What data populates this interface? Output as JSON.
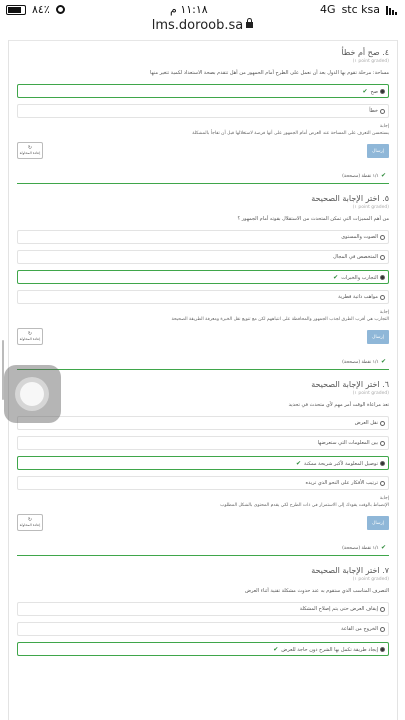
{
  "status_bar": {
    "carrier": "stc ksa",
    "network": "4G",
    "time": "١١:١٨ م",
    "battery": "٨٤٪"
  },
  "browser": {
    "url": "lms.doroob.sa"
  },
  "questions": [
    {
      "title": "٤. صح أم خطأ",
      "points": "(point graded ١)",
      "text": "مساحة: مرحلة تقوم بها الدول بعد أن نعمل على الطرح أمام الحمهور من أهل تتقدم بصحة الاستعداد لكمية تتغير منها",
      "options": [
        {
          "label": "صح",
          "selected": true,
          "correct": true
        },
        {
          "label": "خطأ",
          "selected": false,
          "correct": false
        }
      ],
      "answer_label": "إجابة",
      "answer_text": "يستحسن التعرف على المساحة عند العرض أمام الجمهور على أنها فرصة لاستغلالها قبل أن تفاجأ بالمشكلة",
      "send_label": "إرسال",
      "retry_label": "إعادة المحاولة",
      "result": "١/١ نقطة (مصححة)"
    },
    {
      "title": "٥. اختر الإجابة الصحيحة",
      "points": "(point graded ١)",
      "text": "من أهم المميزات التي تمكن المتحدث من الاستقلال بقوته أمام الجمهور ؟",
      "options": [
        {
          "label": "الصوت والمستوى",
          "selected": false,
          "correct": false
        },
        {
          "label": "المتخصص في المجال",
          "selected": false,
          "correct": false
        },
        {
          "label": "التجارب والخبرات",
          "selected": true,
          "correct": true
        },
        {
          "label": "مواهب ذاتية فطرية",
          "selected": false,
          "correct": false
        }
      ],
      "answer_label": "إجابة",
      "answer_text": "التجارب هي أقرب الطرق لجذب الجمهور والمحافظة على انتباههم لكن مع تنويع نقل الخبرة ومعرفة الطريقة الصحيحة",
      "send_label": "إرسال",
      "retry_label": "إعادة المحاولة",
      "result": "١/١ نقطة (مصححة)"
    },
    {
      "title": "٦. اختر الإجابة الصحيحة",
      "points": "(point graded ١)",
      "text": "تعد مراعاة الوقت أمر مهم لأي متحدث في تحديد",
      "options": [
        {
          "label": "نقل العرض",
          "selected": false,
          "correct": false
        },
        {
          "label": "بين المعلومات التي ستعرضها",
          "selected": false,
          "correct": false
        },
        {
          "label": "توصيل المعلومة لأكبر شريحة ممكنة",
          "selected": true,
          "correct": true
        },
        {
          "label": "ترتيب الأفكار على النحو الذي تريده",
          "selected": false,
          "correct": false
        }
      ],
      "answer_label": "إجابة",
      "answer_text": "الإنضباط بالوقت يقودك إلى الاستمرار في ذات الطرح لكي يقدم المحتوى بالشكل المطلوب",
      "send_label": "إرسال",
      "retry_label": "إعادة المحاولة",
      "result": "١/١ نقطة (مصححة)"
    },
    {
      "title": "٧. اختر الإجابة الصحيحة",
      "points": "(point graded ١)",
      "text": "التصرف المناسب الذي ستقوم به عند حدوث مشكلة تقنية أثناء العرض",
      "options": [
        {
          "label": "إيقاف العرض حتى يتم إصلاح المشكلة",
          "selected": false,
          "correct": false
        },
        {
          "label": "الخروج من القاعة",
          "selected": false,
          "correct": false
        },
        {
          "label": "إيجاد طريقة تكمل بها الشرح دون حاجة للعرض",
          "selected": true,
          "correct": true
        }
      ]
    }
  ]
}
